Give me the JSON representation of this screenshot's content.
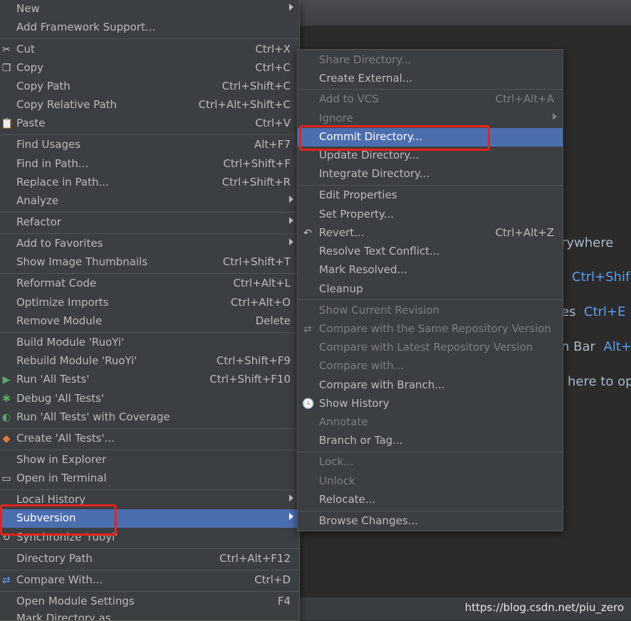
{
  "context_menu": {
    "items": [
      {
        "label": "New",
        "submenu": true
      },
      {
        "label": "Add Framework Support..."
      },
      {
        "label": "Cut",
        "shortcut": "Ctrl+X",
        "icon": "scissors-icon"
      },
      {
        "label": "Copy",
        "shortcut": "Ctrl+C",
        "icon": "copy-icon"
      },
      {
        "label": "Copy Path",
        "shortcut": "Ctrl+Shift+C"
      },
      {
        "label": "Copy Relative Path",
        "shortcut": "Ctrl+Alt+Shift+C"
      },
      {
        "label": "Paste",
        "shortcut": "Ctrl+V",
        "icon": "paste-icon"
      },
      {
        "label": "Find Usages",
        "shortcut": "Alt+F7"
      },
      {
        "label": "Find in Path...",
        "shortcut": "Ctrl+Shift+F"
      },
      {
        "label": "Replace in Path...",
        "shortcut": "Ctrl+Shift+R"
      },
      {
        "label": "Analyze",
        "submenu": true
      },
      {
        "label": "Refactor",
        "submenu": true
      },
      {
        "label": "Add to Favorites",
        "submenu": true
      },
      {
        "label": "Show Image Thumbnails",
        "shortcut": "Ctrl+Shift+T"
      },
      {
        "label": "Reformat Code",
        "shortcut": "Ctrl+Alt+L"
      },
      {
        "label": "Optimize Imports",
        "shortcut": "Ctrl+Alt+O"
      },
      {
        "label": "Remove Module",
        "shortcut": "Delete"
      },
      {
        "label": "Build Module 'RuoYi'"
      },
      {
        "label": "Rebuild Module 'RuoYi'",
        "shortcut": "Ctrl+Shift+F9"
      },
      {
        "label": "Run 'All Tests'",
        "shortcut": "Ctrl+Shift+F10",
        "icon": "run-icon"
      },
      {
        "label": "Debug 'All Tests'",
        "icon": "debug-icon"
      },
      {
        "label": "Run 'All Tests' with Coverage",
        "icon": "coverage-icon"
      },
      {
        "label": "Create 'All Tests'...",
        "icon": "create-test-icon"
      },
      {
        "label": "Show in Explorer"
      },
      {
        "label": "Open in Terminal",
        "icon": "terminal-icon"
      },
      {
        "label": "Local History",
        "submenu": true
      },
      {
        "label": "Subversion",
        "submenu": true,
        "selected": true
      },
      {
        "label": "Synchronize 'ruoyi'",
        "icon": "sync-icon"
      },
      {
        "label": "Directory Path",
        "shortcut": "Ctrl+Alt+F12"
      },
      {
        "label": "Compare With...",
        "shortcut": "Ctrl+D",
        "icon": "compare-icon"
      },
      {
        "label": "Open Module Settings",
        "shortcut": "F4"
      },
      {
        "label": "Mark Directory as"
      }
    ]
  },
  "subversion_menu": {
    "items": [
      {
        "label": "Share Directory...",
        "disabled": true
      },
      {
        "label": "Create External..."
      },
      {
        "label": "Add to VCS",
        "shortcut": "Ctrl+Alt+A",
        "disabled": true
      },
      {
        "label": "Ignore",
        "submenu": true,
        "disabled": true
      },
      {
        "label": "Commit Directory...",
        "selected": true
      },
      {
        "label": "Update Directory..."
      },
      {
        "label": "Integrate Directory..."
      },
      {
        "label": "Edit Properties"
      },
      {
        "label": "Set Property..."
      },
      {
        "label": "Revert...",
        "shortcut": "Ctrl+Alt+Z",
        "icon": "revert-icon"
      },
      {
        "label": "Resolve Text Conflict..."
      },
      {
        "label": "Mark Resolved..."
      },
      {
        "label": "Cleanup"
      },
      {
        "label": "Show Current Revision",
        "disabled": true
      },
      {
        "label": "Compare with the Same Repository Version",
        "disabled": true,
        "icon": "compare-arrows-icon"
      },
      {
        "label": "Compare with Latest Repository Version",
        "disabled": true
      },
      {
        "label": "Compare with...",
        "disabled": true
      },
      {
        "label": "Compare with Branch..."
      },
      {
        "label": "Show History",
        "icon": "history-icon"
      },
      {
        "label": "Annotate",
        "disabled": true
      },
      {
        "label": "Branch or Tag..."
      },
      {
        "label": "Lock...",
        "disabled": true
      },
      {
        "label": "Unlock",
        "disabled": true
      },
      {
        "label": "Relocate..."
      },
      {
        "label": "Browse Changes..."
      }
    ]
  },
  "editor": {
    "hints": [
      {
        "text": "rywhere",
        "key": ""
      },
      {
        "text": "",
        "key": "Ctrl+Shif"
      },
      {
        "text": "es",
        "key": "Ctrl+E"
      },
      {
        "text": "n Bar",
        "key": "Alt+"
      },
      {
        "text": "here to op",
        "key": ""
      }
    ]
  },
  "watermark": "https://blog.csdn.net/piu_zero",
  "colors": {
    "menu_bg": "#3c3f41",
    "selection": "#4b6eaf",
    "highlight_box": "#e8231c",
    "editor_bg": "#2b2b2b",
    "key_blue": "#589df6"
  }
}
